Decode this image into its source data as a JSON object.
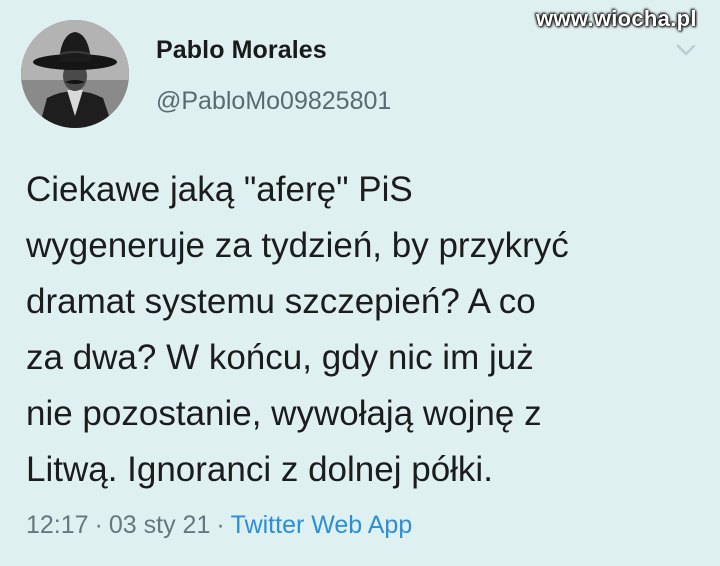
{
  "watermark": "www.wiocha.pl",
  "author": {
    "display_name": "Pablo Morales",
    "handle": "@PabloMo09825801"
  },
  "tweet": {
    "lines": [
      "Ciekawe jaką \"aferę\" PiS",
      "wygeneruje za tydzień, by przykryć",
      "dramat systemu szczepień? A co",
      "za dwa? W końcu, gdy nic im już",
      "nie pozostanie, wywołają wojnę z",
      "Litwą. Ignoranci z dolnej półki."
    ]
  },
  "meta": {
    "time": "12:17",
    "date": "03 sty 21",
    "source": "Twitter Web App",
    "separator": "·"
  },
  "colors": {
    "background": "#dff0f1",
    "link": "#2a8fd6"
  },
  "icons": {
    "menu": "chevron-down-icon"
  }
}
